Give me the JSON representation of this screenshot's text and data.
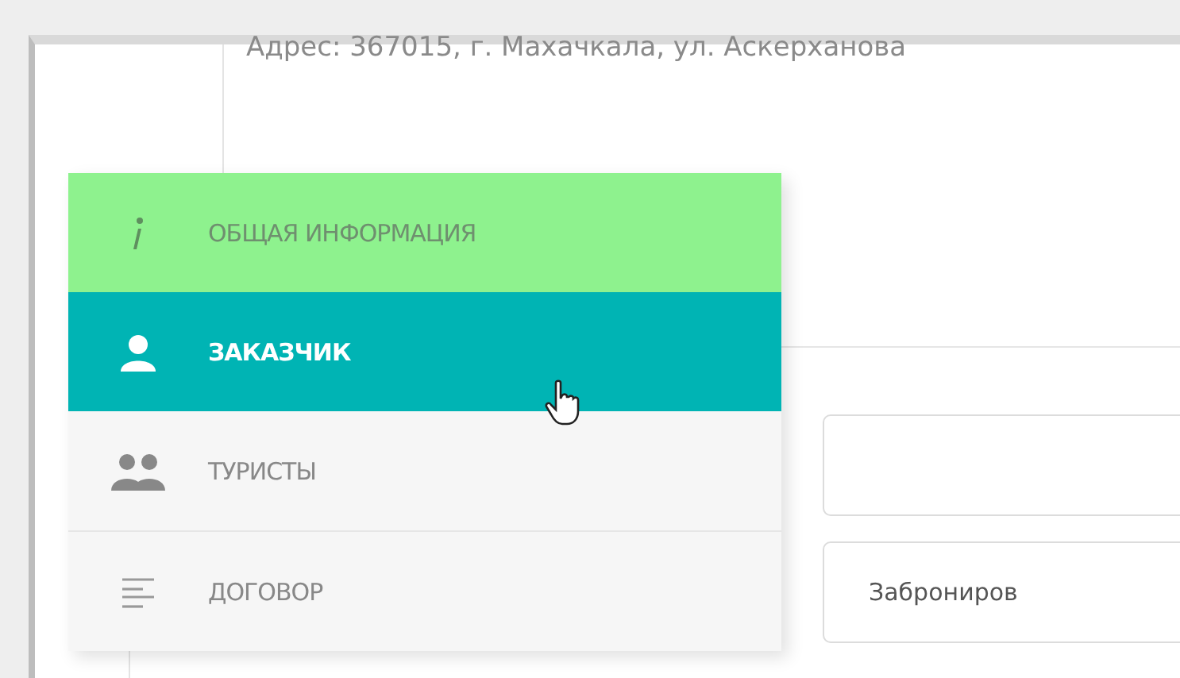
{
  "address": "Адрес: 367015, г. Махачкала, ул. Аскерханова",
  "menu": [
    {
      "kind": "info",
      "label": "ОБЩАЯ ИНФОРМАЦИЯ",
      "selected": false,
      "completed": true
    },
    {
      "kind": "person",
      "label": "ЗАКАЗЧИК",
      "selected": true,
      "completed": false
    },
    {
      "kind": "people",
      "label": "ТУРИСТЫ",
      "selected": false,
      "completed": false
    },
    {
      "kind": "list",
      "label": "ДОГОВОР",
      "selected": false,
      "completed": false
    }
  ],
  "fields": [
    {
      "kind": "blank"
    },
    {
      "kind": "filled",
      "value": "Заброниров"
    }
  ]
}
